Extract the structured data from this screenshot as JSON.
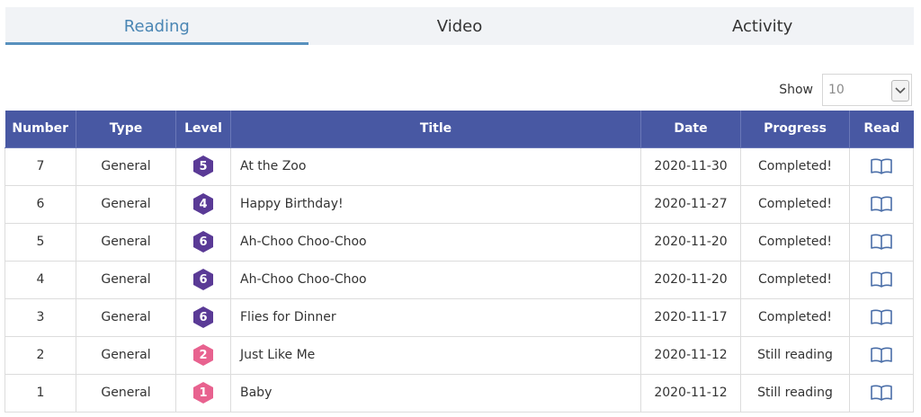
{
  "tabs": [
    {
      "label": "Reading",
      "active": true
    },
    {
      "label": "Video",
      "active": false
    },
    {
      "label": "Activity",
      "active": false
    }
  ],
  "show": {
    "label": "Show",
    "value": "10"
  },
  "table": {
    "headers": [
      "Number",
      "Type",
      "Level",
      "Title",
      "Date",
      "Progress",
      "Read"
    ],
    "rows": [
      {
        "number": "7",
        "type": "General",
        "level": "5",
        "level_color": "#5a3a96",
        "title": "At the Zoo",
        "date": "2020-11-30",
        "progress": "Completed!"
      },
      {
        "number": "6",
        "type": "General",
        "level": "4",
        "level_color": "#5a3a96",
        "title": "Happy Birthday!",
        "date": "2020-11-27",
        "progress": "Completed!"
      },
      {
        "number": "5",
        "type": "General",
        "level": "6",
        "level_color": "#5a3a96",
        "title": "Ah-Choo Choo-Choo",
        "date": "2020-11-20",
        "progress": "Completed!"
      },
      {
        "number": "4",
        "type": "General",
        "level": "6",
        "level_color": "#5a3a96",
        "title": "Ah-Choo Choo-Choo",
        "date": "2020-11-20",
        "progress": "Completed!"
      },
      {
        "number": "3",
        "type": "General",
        "level": "6",
        "level_color": "#5a3a96",
        "title": "Flies for Dinner",
        "date": "2020-11-17",
        "progress": "Completed!"
      },
      {
        "number": "2",
        "type": "General",
        "level": "2",
        "level_color": "#e8628f",
        "title": "Just Like Me",
        "date": "2020-11-12",
        "progress": "Still reading"
      },
      {
        "number": "1",
        "type": "General",
        "level": "1",
        "level_color": "#e8628f",
        "title": "Baby",
        "date": "2020-11-12",
        "progress": "Still reading"
      }
    ]
  },
  "colors": {
    "header_bg": "#4858a3",
    "tab_active": "#4a86b4",
    "book_icon": "#4a6ea8"
  },
  "icons": {
    "read": "open-book-icon",
    "select": "chevron-down-icon"
  }
}
